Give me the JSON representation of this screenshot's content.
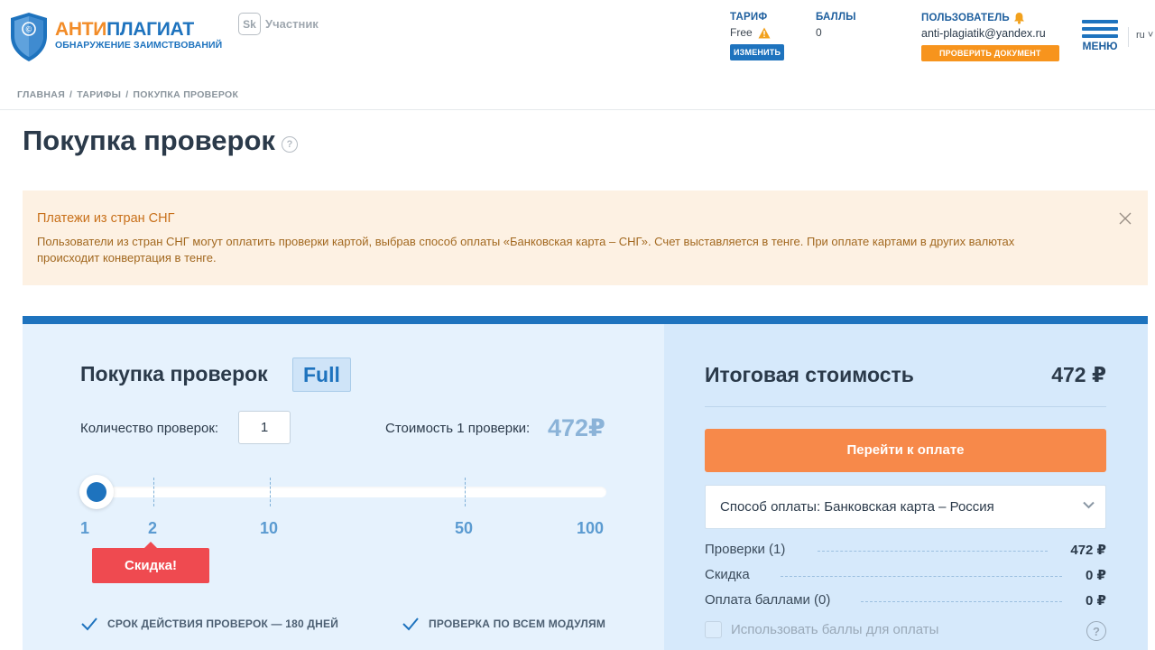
{
  "header": {
    "logo": {
      "title_part1": "АНТИ",
      "title_part2": "ПЛАГИАТ",
      "subtitle": "ОБНАРУЖЕНИЕ ЗАИМСТВОВАНИЙ"
    },
    "sk": {
      "mark": "Sk",
      "label": "Участник"
    },
    "tariff": {
      "label": "ТАРИФ",
      "value": "Free",
      "button": "ИЗМЕНИТЬ"
    },
    "points": {
      "label": "БАЛЛЫ",
      "value": "0"
    },
    "user": {
      "label": "ПОЛЬЗОВАТЕЛЬ",
      "email": "anti-plagiatik@yandex.ru",
      "button": "ПРОВЕРИТЬ ДОКУМЕНТ"
    },
    "menu_label": "МЕНЮ",
    "lang": "ru"
  },
  "breadcrumb": [
    "ГЛАВНАЯ",
    "ТАРИФЫ",
    "ПОКУПКА ПРОВЕРОК"
  ],
  "breadcrumb_sep": "/",
  "page_title": "Покупка проверок",
  "help_glyph": "?",
  "alert": {
    "title": "Платежи из стран СНГ",
    "text": "Пользователи из стран СНГ могут оплатить проверки картой, выбрав способ оплаты «Банковская карта – СНГ». Счет выставляется в тенге. При оплате картами в других валютах происходит конвертация в тенге."
  },
  "purchase": {
    "title": "Покупка проверок",
    "badge": "Full",
    "qty_label": "Количество проверок:",
    "qty_value": "1",
    "cost_label": "Стоимость 1 проверки:",
    "cost_value": "472₽",
    "slider": {
      "ticks": [
        "1",
        "2",
        "10",
        "50",
        "100"
      ],
      "selected": "1"
    },
    "discount_label": "Скидка!",
    "features": [
      "СРОК ДЕЙСТВИЯ ПРОВЕРОК — 180 ДНЕЙ",
      "ПРОВЕРКА ПО ВСЕМ МОДУЛЯМ"
    ]
  },
  "summary": {
    "title": "Итоговая стоимость",
    "total": "472 ₽",
    "pay_button": "Перейти к оплате",
    "payment_method": "Способ оплаты: Банковская карта – Россия",
    "lines": [
      {
        "label": "Проверки (1)",
        "amount": "472 ₽"
      },
      {
        "label": "Скидка",
        "amount": "0 ₽"
      },
      {
        "label": "Оплата баллами (0)",
        "amount": "0 ₽"
      }
    ],
    "use_points_label": "Использовать баллы для оплаты",
    "use_points_checked": false
  },
  "colors": {
    "brand_blue": "#1e73be",
    "brand_orange": "#f28c28",
    "pay_button": "#f7894a",
    "discount": "#ef4a50",
    "alert_bg": "#fdf1e3"
  }
}
